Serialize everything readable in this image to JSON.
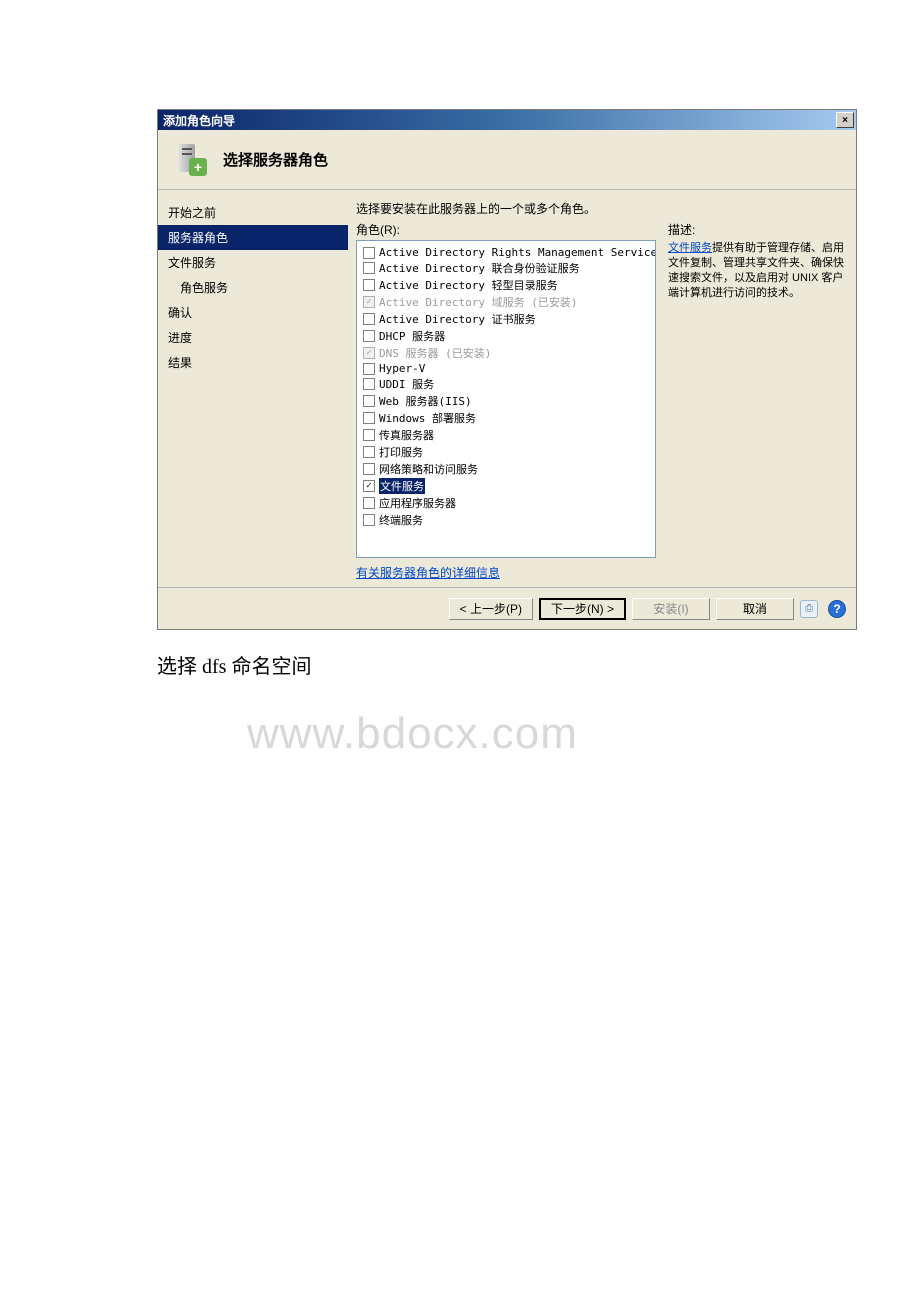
{
  "window": {
    "title": "添加角色向导",
    "close_symbol": "×"
  },
  "header": {
    "title": "选择服务器角色"
  },
  "sidebar": {
    "items": [
      {
        "label": "开始之前",
        "selected": false,
        "indent": false
      },
      {
        "label": "服务器角色",
        "selected": true,
        "indent": false
      },
      {
        "label": "文件服务",
        "selected": false,
        "indent": false
      },
      {
        "label": "角色服务",
        "selected": false,
        "indent": true
      },
      {
        "label": "确认",
        "selected": false,
        "indent": false
      },
      {
        "label": "进度",
        "selected": false,
        "indent": false
      },
      {
        "label": "结果",
        "selected": false,
        "indent": false
      }
    ]
  },
  "main": {
    "instruction": "选择要安装在此服务器上的一个或多个角色。",
    "roles_label": "角色(R):",
    "roles": [
      {
        "label": "Active Directory Rights Management Services",
        "checked": false,
        "disabled": false
      },
      {
        "label": "Active Directory 联合身份验证服务",
        "checked": false,
        "disabled": false
      },
      {
        "label": "Active Directory 轻型目录服务",
        "checked": false,
        "disabled": false
      },
      {
        "label": "Active Directory 域服务  (已安装)",
        "checked": true,
        "disabled": true
      },
      {
        "label": "Active Directory 证书服务",
        "checked": false,
        "disabled": false
      },
      {
        "label": "DHCP 服务器",
        "checked": false,
        "disabled": false
      },
      {
        "label": "DNS 服务器  (已安装)",
        "checked": true,
        "disabled": true
      },
      {
        "label": "Hyper-V",
        "checked": false,
        "disabled": false
      },
      {
        "label": "UDDI 服务",
        "checked": false,
        "disabled": false
      },
      {
        "label": "Web 服务器(IIS)",
        "checked": false,
        "disabled": false
      },
      {
        "label": "Windows 部署服务",
        "checked": false,
        "disabled": false
      },
      {
        "label": "传真服务器",
        "checked": false,
        "disabled": false
      },
      {
        "label": "打印服务",
        "checked": false,
        "disabled": false
      },
      {
        "label": "网络策略和访问服务",
        "checked": false,
        "disabled": false
      },
      {
        "label": "文件服务",
        "checked": true,
        "disabled": false,
        "listselected": true
      },
      {
        "label": "应用程序服务器",
        "checked": false,
        "disabled": false
      },
      {
        "label": "终端服务",
        "checked": false,
        "disabled": false
      }
    ],
    "more_link": "有关服务器角色的详细信息",
    "desc_label": "描述:",
    "desc_link_text": "文件服务",
    "desc_rest": "提供有助于管理存储、启用文件复制、管理共享文件夹、确保快速搜索文件，以及启用对 UNIX 客户端计算机进行访问的技术。"
  },
  "footer": {
    "prev": "< 上一步(P)",
    "next": "下一步(N) >",
    "install": "安装(I)",
    "cancel": "取消",
    "help": "?"
  },
  "caption": "选择 dfs 命名空间",
  "watermark": "www.bdocx.com"
}
